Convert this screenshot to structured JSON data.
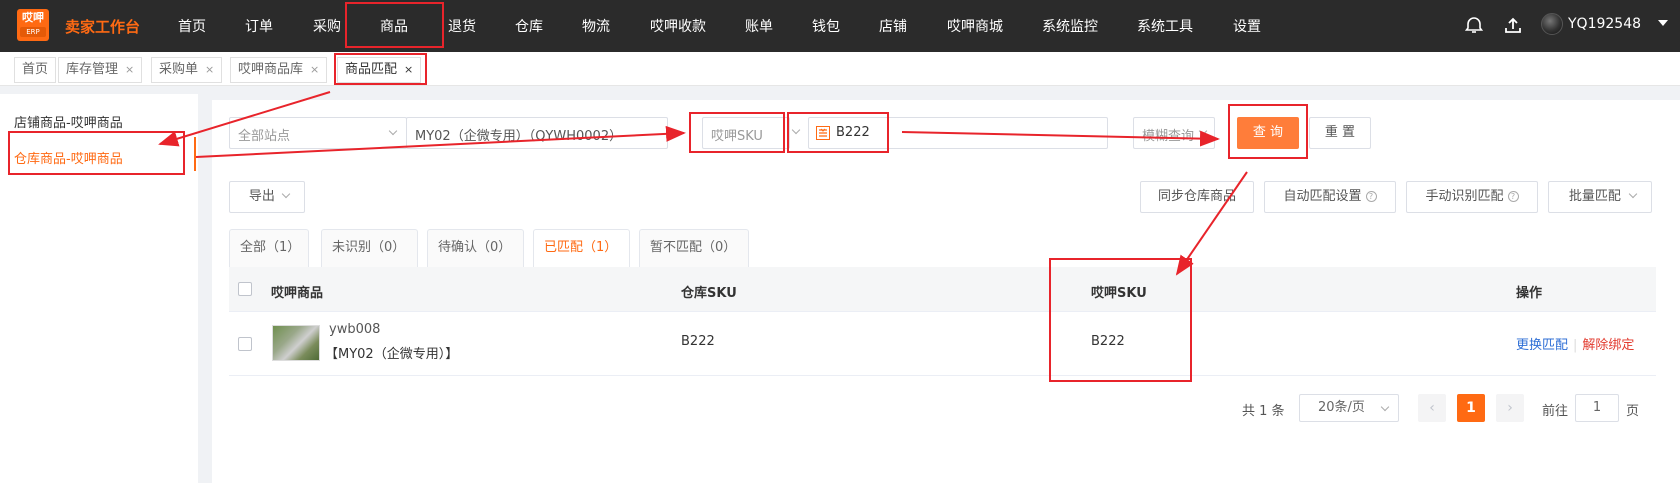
{
  "nav": {
    "logo_top": "哎呷",
    "logo_bottom": "ERP",
    "brand": "卖家工作台",
    "menu": [
      "首页",
      "订单",
      "采购",
      "商品",
      "退货",
      "仓库",
      "物流",
      "哎呷收款",
      "账单",
      "钱包",
      "店铺",
      "哎呷商城",
      "系统监控",
      "系统工具",
      "设置"
    ],
    "username": "YQ192548"
  },
  "tabs": [
    {
      "label": "首页",
      "closable": false
    },
    {
      "label": "库存管理",
      "closable": true
    },
    {
      "label": "采购单",
      "closable": true
    },
    {
      "label": "哎呷商品库",
      "closable": true
    },
    {
      "label": "商品匹配",
      "closable": true,
      "active": true
    }
  ],
  "tab_close_glyph": "×",
  "sidebar": {
    "items": [
      {
        "label": "店铺商品-哎呷商品"
      },
      {
        "label": "仓库商品-哎呷商品",
        "active": true
      }
    ]
  },
  "filters": {
    "site_placeholder": "全部站点",
    "warehouse_value": "MY02（企微专用）（QYWH0002）",
    "sku_type_value": "哎呷SKU",
    "sku_value": "B222",
    "match_mode_value": "模糊查询",
    "query_label": "查 询",
    "reset_label": "重 置"
  },
  "toolbar": {
    "export_label": "导出",
    "sync_label": "同步仓库商品",
    "auto_match_label": "自动匹配设置",
    "manual_label": "手动识别匹配",
    "batch_label": "批量匹配",
    "help_glyph": "?"
  },
  "status_tabs": [
    {
      "label": "全部（1）"
    },
    {
      "label": "未识别（0）"
    },
    {
      "label": "待确认（0）"
    },
    {
      "label": "已匹配（1）",
      "active": true
    },
    {
      "label": "暂不匹配（0）"
    }
  ],
  "table": {
    "headers": {
      "product": "哎呷商品",
      "warehouse_sku": "仓库SKU",
      "yaya_sku": "哎呷SKU",
      "actions": "操作"
    },
    "rows": [
      {
        "product_name": "ywb008",
        "product_warehouse": "【MY02（企微专用）】",
        "warehouse_sku": "B222",
        "yaya_sku": "B222",
        "action_change": "更换匹配",
        "action_unbind": "解除绑定"
      }
    ],
    "action_separator": "|"
  },
  "pagination": {
    "total_text": "共 1 条",
    "page_size": "20条/页",
    "prev_glyph": "‹",
    "next_glyph": "›",
    "current_page": "1",
    "goto_prefix": "前往",
    "goto_value": "1",
    "goto_suffix": "页"
  },
  "colors": {
    "accent": "#ff6a13",
    "annotation": "#e8242b",
    "link": "#2f6fd6",
    "danger": "#e23a2e"
  }
}
